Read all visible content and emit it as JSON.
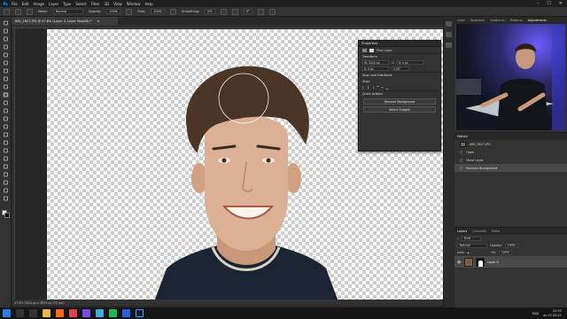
{
  "app": {
    "logo": "Ps",
    "menu": [
      "File",
      "Edit",
      "Image",
      "Layer",
      "Type",
      "Select",
      "Filter",
      "3D",
      "View",
      "Window",
      "Help"
    ]
  },
  "options_bar": {
    "mode_label": "Mode:",
    "mode_value": "Normal",
    "opacity_label": "Opacity:",
    "opacity_value": "100%",
    "flow_label": "Flow:",
    "flow_value": "100%",
    "smoothing_label": "Smoothing:",
    "smoothing_value": "0%",
    "angle_value": "0°"
  },
  "document_tab": {
    "title": "IMG_1627.JPG @ 47.6% (Layer 0, Layer Mask/8) *",
    "close": "×"
  },
  "status_bar": {
    "text": "47.6%    3024 px x 3024 px (72 ppi)"
  },
  "properties": {
    "title": "Properties",
    "pixel_layer_label": "Pixel Layer",
    "transform_label": "Transform",
    "w_value": "W: 3024 px",
    "h_value": "H: 0 px",
    "x_value": "X: 0 px",
    "angle_value": "0.00°",
    "align_title": "Align and Distribute",
    "align_label": "Align:",
    "quick_actions_title": "Quick Actions",
    "remove_bg_label": "Remove Background",
    "select_subject_label": "Select Subject"
  },
  "panel_tabs": {
    "tabs": [
      "Color",
      "Swatches",
      "Gradients",
      "Patterns",
      "Adjustments"
    ],
    "active_index": 4
  },
  "history": {
    "title": "History",
    "source": "IMG_1627.JPG",
    "items": [
      "Open",
      "Make Layer",
      "Remove Background"
    ],
    "selected_index": 2
  },
  "layers": {
    "tabs": [
      "Layers",
      "Channels",
      "Paths"
    ],
    "filter_label": "Kind",
    "blend_mode": "Normal",
    "opacity_label": "Opacity:",
    "opacity_value": "100%",
    "lock_label": "Lock:",
    "fill_label": "Fill:",
    "fill_value": "100%",
    "layer_name": "Layer 0"
  },
  "taskbar": {
    "lang": "ENG",
    "time": "23:55",
    "date": "вс 07.03.21"
  },
  "colors": {
    "accent": "#31a8ff",
    "app_bg": "#282828",
    "panel_bg": "#323232",
    "shirt": "#1b2433",
    "webcam_glow": "#5a4bff"
  }
}
